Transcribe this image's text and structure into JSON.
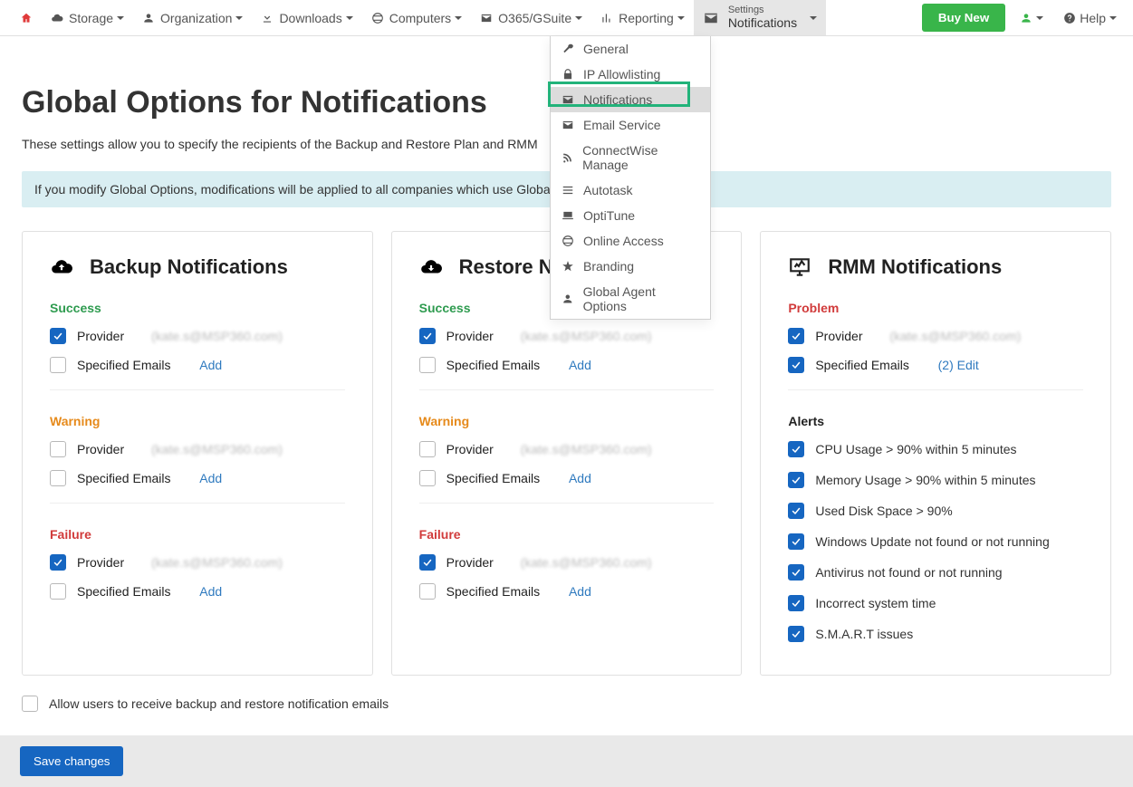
{
  "nav": {
    "storage": "Storage",
    "organization": "Organization",
    "downloads": "Downloads",
    "computers": "Computers",
    "o365": "O365/GSuite",
    "reporting": "Reporting",
    "settings_label": "Settings",
    "settings_value": "Notifications",
    "buy": "Buy New",
    "help": "Help"
  },
  "dropdown": {
    "items": [
      "General",
      "IP Allowlisting",
      "Notifications",
      "Email Service",
      "ConnectWise Manage",
      "Autotask",
      "OptiTune",
      "Online Access",
      "Branding",
      "Global Agent Options"
    ]
  },
  "page": {
    "title": "Global Options for Notifications",
    "subtitle": "These settings allow you to specify the recipients of the Backup and Restore Plan and RMM",
    "banner": "If you modify Global Options, modifications will be applied to all companies which use Global O"
  },
  "labels": {
    "provider": "Provider",
    "provider_email": "(kate.s@MSP360.com)",
    "specified_emails": "Specified Emails",
    "add": "Add",
    "success": "Success",
    "warning": "Warning",
    "failure": "Failure",
    "problem": "Problem",
    "alerts": "Alerts",
    "edit2": "(2) Edit",
    "allow_users": "Allow users to receive backup and restore notification emails",
    "save": "Save changes"
  },
  "cards": {
    "backup": "Backup Notifications",
    "restore": "Restore Notifications",
    "rmm": "RMM Notifications"
  },
  "alerts": [
    "CPU Usage > 90% within 5 minutes",
    "Memory Usage > 90% within 5 minutes",
    "Used Disk Space > 90%",
    "Windows Update not found or not running",
    "Antivirus not found or not running",
    "Incorrect system time",
    "S.M.A.R.T issues"
  ]
}
